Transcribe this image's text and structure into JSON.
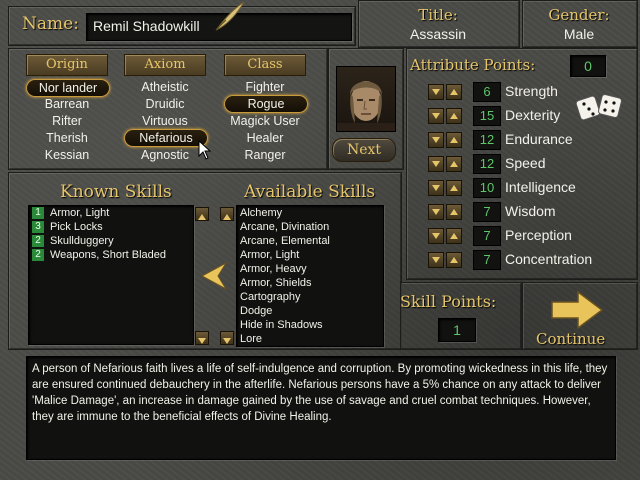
{
  "name": {
    "label": "Name:",
    "value": "Remil Shadowkill"
  },
  "title": {
    "label": "Title:",
    "value": "Assassin"
  },
  "gender": {
    "label": "Gender:",
    "value": "Male"
  },
  "origin": {
    "header": "Origin",
    "options": [
      "Nor lander",
      "Barrean",
      "Rifter",
      "Therish",
      "Kessian"
    ],
    "selected": "Nor lander"
  },
  "axiom": {
    "header": "Axiom",
    "options": [
      "Atheistic",
      "Druidic",
      "Virtuous",
      "Nefarious",
      "Agnostic"
    ],
    "selected": "Nefarious"
  },
  "class": {
    "header": "Class",
    "options": [
      "Fighter",
      "Rogue",
      "Magick User",
      "Healer",
      "Ranger"
    ],
    "selected": "Rogue"
  },
  "next_label": "Next",
  "attributes": {
    "header": "Attribute Points:",
    "points": "0",
    "items": [
      {
        "name": "Strength",
        "value": "6"
      },
      {
        "name": "Dexterity",
        "value": "15"
      },
      {
        "name": "Endurance",
        "value": "12"
      },
      {
        "name": "Speed",
        "value": "12"
      },
      {
        "name": "Intelligence",
        "value": "10"
      },
      {
        "name": "Wisdom",
        "value": "7"
      },
      {
        "name": "Perception",
        "value": "7"
      },
      {
        "name": "Concentration",
        "value": "7"
      }
    ]
  },
  "known_skills": {
    "header": "Known Skills",
    "items": [
      {
        "rank": "1",
        "name": "Armor, Light"
      },
      {
        "rank": "3",
        "name": "Pick Locks"
      },
      {
        "rank": "2",
        "name": "Skullduggery"
      },
      {
        "rank": "2",
        "name": "Weapons, Short Bladed"
      }
    ]
  },
  "available_skills": {
    "header": "Available Skills",
    "items": [
      "Alchemy",
      "Arcane, Divination",
      "Arcane, Elemental",
      "Armor, Light",
      "Armor, Heavy",
      "Armor, Shields",
      "Cartography",
      "Dodge",
      "Hide in Shadows",
      "Lore"
    ]
  },
  "skill_points": {
    "label": "Skill Points:",
    "value": "1"
  },
  "continue_label": "Continue",
  "description": "A person of Nefarious faith lives a life of self-indulgence and corruption. By promoting wickedness in this life, they are ensured continued debauchery in the afterlife. Nefarious persons have a 5% chance on any attack to deliver 'Malice Damage', an increase in damage gained by the use of savage and cruel combat techniques. However, they are immune to the beneficial effects of Divine Healing.",
  "colors": {
    "gold": "#e6c56a",
    "green": "#5ec76a",
    "rank_bg": "#2a8a3a"
  }
}
